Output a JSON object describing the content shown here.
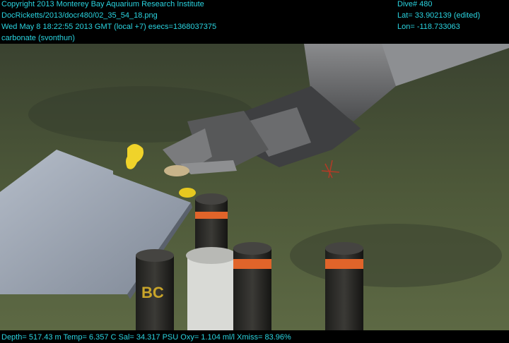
{
  "overlay": {
    "copyright": "Copyright 2013 Monterey Bay Aquarium Research Institute",
    "file": "DocRicketts/2013/docr480/02_35_54_18.png",
    "datetime": "Wed May  8 18:22:55 2013 GMT (local +7)  esecs=1368037375",
    "label": "carbonate (svonthun)",
    "dive": "Dive# 480",
    "lat": "Lat= 33.902139 (edited)",
    "lon": "Lon= -118.733063",
    "telemetry": "Depth= 517.43 m  Temp= 6.357 C  Sal= 34.317 PSU  Oxy= 1.104 ml/l  Xmiss= 83.96%"
  },
  "colors": {
    "overlay_text": "#2ad4e0",
    "seafloor": "#4f5a3c",
    "tray": "#9aa3b0",
    "arm": "#6d6e70",
    "tube_band": "#e0642a",
    "float": "#f0d32a"
  },
  "icons": [
    "manipulator-arm",
    "sample-tray",
    "push-core-tubes",
    "yellow-float"
  ]
}
